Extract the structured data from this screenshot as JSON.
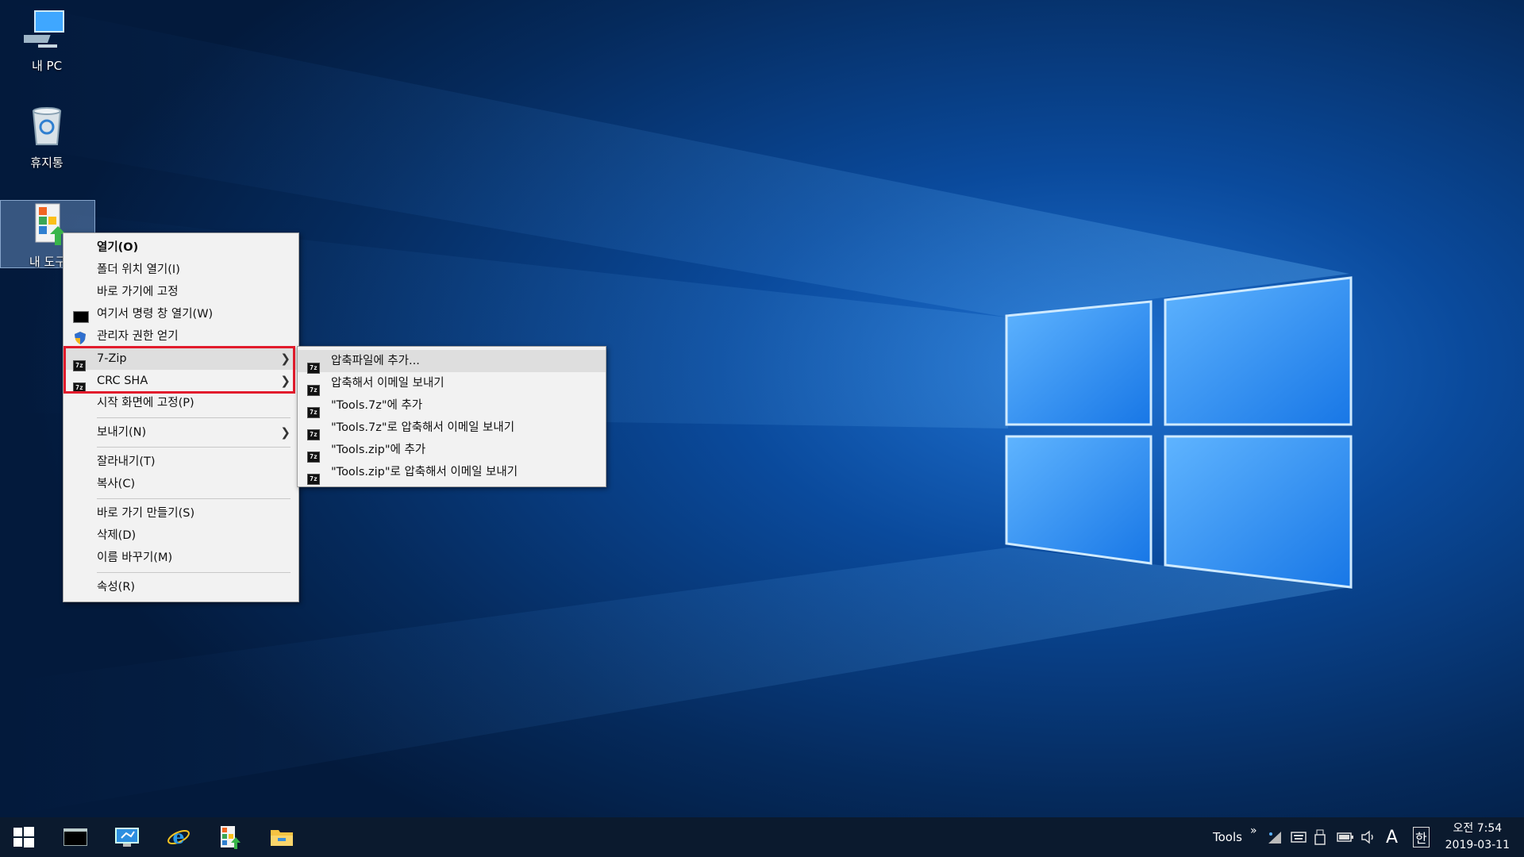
{
  "desktop": {
    "icons": [
      {
        "label": "내 PC",
        "icon": "computer-icon"
      },
      {
        "label": "휴지통",
        "icon": "recycle-bin-icon"
      },
      {
        "label": "내 도구",
        "icon": "tools-folder-icon"
      }
    ]
  },
  "context_menu": {
    "items": [
      {
        "label": "열기(O)"
      },
      {
        "label": "폴더 위치 열기(I)"
      },
      {
        "label": "바로 가기에 고정"
      },
      {
        "label": "여기서 명령 창 열기(W)",
        "icon": "command-prompt-icon"
      },
      {
        "label": "관리자 권한 얻기",
        "icon": "shield-icon"
      },
      {
        "label": "7-Zip",
        "icon": "7zip-icon"
      },
      {
        "label": "CRC SHA",
        "icon": "7zip-icon"
      },
      {
        "label": "시작 화면에 고정(P)"
      },
      {
        "label": "보내기(N)"
      },
      {
        "label": "잘라내기(T)"
      },
      {
        "label": "복사(C)"
      },
      {
        "label": "바로 가기 만들기(S)"
      },
      {
        "label": "삭제(D)"
      },
      {
        "label": "이름 바꾸기(M)"
      },
      {
        "label": "속성(R)"
      }
    ]
  },
  "submenu_7zip": {
    "items": [
      {
        "label": "압축파일에 추가..."
      },
      {
        "label": "압축해서 이메일 보내기"
      },
      {
        "label": "\"Tools.7z\"에 추가"
      },
      {
        "label": "\"Tools.7z\"로 압축해서 이메일 보내기"
      },
      {
        "label": "\"Tools.zip\"에 추가"
      },
      {
        "label": "\"Tools.zip\"로 압축해서 이메일 보내기"
      }
    ]
  },
  "taskbar": {
    "pinned": [
      "start-icon",
      "command-prompt-icon",
      "remote-desktop-icon",
      "internet-explorer-icon",
      "tools-icon",
      "file-explorer-icon"
    ],
    "toolbar_label": "Tools",
    "overflow": "»",
    "ime_mode": "A",
    "ime_lang": "한",
    "time": "오전 7:54",
    "date": "2019-03-11"
  },
  "colors": {
    "highlight_border": "#e21b2c",
    "wallpaper_base": "#062a5a"
  }
}
